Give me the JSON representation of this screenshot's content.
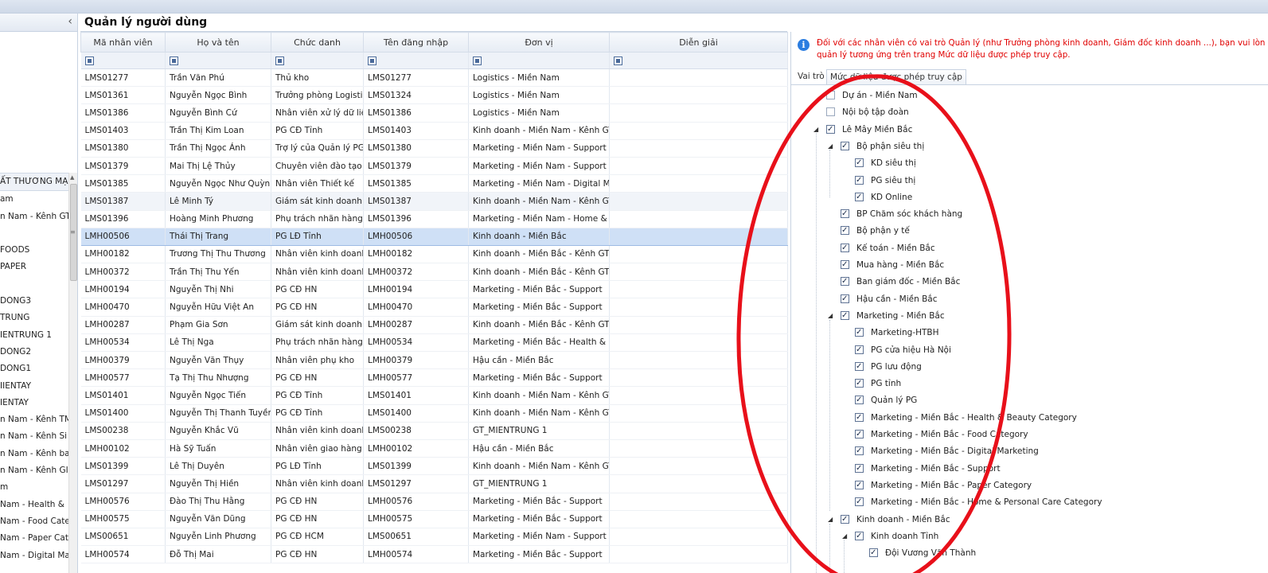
{
  "page_title": "Quản lý người dùng",
  "sidebar": {
    "items": [
      "ẤT THƯƠNG MẠI",
      "am",
      "n Nam - Kênh GT",
      "",
      "FOODS",
      "PAPER",
      "",
      "DONG3",
      "TRUNG",
      "IENTRUNG 1",
      "DONG2",
      "DONG1",
      "IIENTAY",
      "IENTAY",
      "n Nam - Kênh TM",
      "n Nam - Kênh Si",
      "n Nam - Kênh ba",
      "n Nam - Kênh GI",
      "m",
      "Nam - Health &",
      "Nam - Food Cate",
      "Nam - Paper Cat",
      "Nam - Digital Ma"
    ]
  },
  "grid": {
    "columns": [
      "Mã nhân viên",
      "Họ và tên",
      "Chức danh",
      "Tên đăng nhập",
      "Đơn vị",
      "Diễn giải"
    ],
    "rows": [
      [
        "LMS01277",
        "Trần Văn Phú",
        "Thủ kho",
        "LMS01277",
        "Logistics - Miền Nam",
        ""
      ],
      [
        "LMS01361",
        "Nguyễn Ngọc Bình",
        "Trưởng phòng Logistic",
        "LMS01324",
        "Logistics - Miền Nam",
        ""
      ],
      [
        "LMS01386",
        "Nguyễn Bình Cứ",
        "Nhân viên xử lý dữ liệ",
        "LMS01386",
        "Logistics - Miền Nam",
        ""
      ],
      [
        "LMS01403",
        "Trần Thị Kim Loan",
        "PG CĐ Tỉnh",
        "LMS01403",
        "Kinh doanh - Miền Nam - Kênh GT",
        ""
      ],
      [
        "LMS01380",
        "Trần Thị Ngọc Ánh",
        "Trợ lý của Quản lý PG",
        "LMS01380",
        "Marketing - Miền Nam - Support",
        ""
      ],
      [
        "LMS01379",
        "Mai Thị Lệ Thủy",
        "Chuyên viên đào tạo",
        "LMS01379",
        "Marketing - Miền Nam - Support",
        ""
      ],
      [
        "LMS01385",
        "Nguyễn Ngọc Như Quỳnh",
        "Nhân viên Thiết kế",
        "LMS01385",
        "Marketing - Miền Nam - Digital Mar",
        ""
      ],
      [
        "LMS01387",
        "Lê Minh Tý",
        "Giám sát kinh doanh",
        "LMS01387",
        "Kinh doanh - Miền Nam - Kênh GT",
        ""
      ],
      [
        "LMS01396",
        "Hoàng Minh Phương",
        "Phụ trách nhãn hàng",
        "LMS01396",
        "Marketing - Miền Nam - Home & Pe",
        ""
      ],
      [
        "LMH00506",
        "Thái Thị Trang",
        "PG LĐ Tỉnh",
        "LMH00506",
        "Kinh doanh - Miền Bắc",
        ""
      ],
      [
        "LMH00182",
        "Trương Thị Thu Thương",
        "Nhân viên kinh doanh",
        "LMH00182",
        "Kinh doanh - Miền Bắc - Kênh GT",
        ""
      ],
      [
        "LMH00372",
        "Trần Thị Thu Yến",
        "Nhân viên kinh doanh",
        "LMH00372",
        "Kinh doanh - Miền Bắc - Kênh GT",
        ""
      ],
      [
        "LMH00194",
        "Nguyễn Thị Nhi",
        "PG CĐ HN",
        "LMH00194",
        "Marketing - Miền Bắc - Support",
        ""
      ],
      [
        "LMH00470",
        "Nguyễn Hữu Việt An",
        "PG CĐ HN",
        "LMH00470",
        "Marketing - Miền Bắc - Support",
        ""
      ],
      [
        "LMH00287",
        "Phạm Gia Sơn",
        "Giám sát kinh doanh",
        "LMH00287",
        "Kinh doanh - Miền Bắc - Kênh GT",
        ""
      ],
      [
        "LMH00534",
        "Lê Thị Nga",
        "Phụ trách nhãn hàng",
        "LMH00534",
        "Marketing - Miền Bắc - Health & Be",
        ""
      ],
      [
        "LMH00379",
        "Nguyễn Văn Thụy",
        "Nhân viên phụ kho",
        "LMH00379",
        "Hậu cần - Miền Bắc",
        ""
      ],
      [
        "LMH00577",
        "Tạ Thị Thu Nhượng",
        "PG CĐ HN",
        "LMH00577",
        "Marketing - Miền Bắc - Support",
        ""
      ],
      [
        "LMS01401",
        "Nguyễn Ngọc Tiến",
        "PG CĐ Tỉnh",
        "LMS01401",
        "Kinh doanh - Miền Nam - Kênh GT",
        ""
      ],
      [
        "LMS01400",
        "Nguyễn Thị Thanh Tuyền",
        "PG CĐ Tỉnh",
        "LMS01400",
        "Kinh doanh - Miền Nam - Kênh GT",
        ""
      ],
      [
        "LMS00238",
        "Nguyễn Khắc Vũ",
        "Nhân viên kinh doanh",
        "LMS00238",
        "GT_MIENTRUNG 1",
        ""
      ],
      [
        "LMH00102",
        "Hà Sỹ Tuấn",
        "Nhân viên giao hàng x",
        "LMH00102",
        "Hậu cần - Miền Bắc",
        ""
      ],
      [
        "LMS01399",
        "Lê Thị Duyên",
        "PG LĐ Tỉnh",
        "LMS01399",
        "Kinh doanh - Miền Nam - Kênh GT",
        ""
      ],
      [
        "LMS01297",
        "Nguyễn Thị Hiền",
        "Nhân viên kinh doanh",
        "LMS01297",
        "GT_MIENTRUNG 1",
        ""
      ],
      [
        "LMH00576",
        "Đào Thị Thu Hằng",
        "PG CĐ HN",
        "LMH00576",
        "Marketing - Miền Bắc - Support",
        ""
      ],
      [
        "LMH00575",
        "Nguyễn Văn Dũng",
        "PG CĐ HN",
        "LMH00575",
        "Marketing - Miền Bắc - Support",
        ""
      ],
      [
        "LMS00651",
        "Nguyễn Linh Phương",
        "PG CĐ HCM",
        "LMS00651",
        "Marketing - Miền Nam - Support",
        ""
      ],
      [
        "LMH00574",
        "Đỗ Thị Mai",
        "PG CĐ HN",
        "LMH00574",
        "Marketing - Miền Bắc - Support",
        ""
      ]
    ]
  },
  "right_panel": {
    "notice_line1": "Đối với các nhân viên có vai trò Quản lý (như Trưởng phòng kinh doanh, Giám đốc kinh doanh ...), bạn vui lòn",
    "notice_line2": "quản lý tương ứng trên trang Mức dữ liệu được phép truy cập.",
    "tabs": [
      "Vai trò",
      "Mức dữ liệu được phép truy cập"
    ],
    "tree": [
      {
        "label": "Dự án - Miền Nam",
        "level": 0,
        "checked": false,
        "expand": ""
      },
      {
        "label": "Nội bộ tập đoàn",
        "level": 0,
        "checked": false,
        "expand": ""
      },
      {
        "label": "Lê Mây Miền Bắc",
        "level": 0,
        "checked": true,
        "expand": "◢"
      },
      {
        "label": "Bộ phận siêu thị",
        "level": 1,
        "checked": true,
        "expand": "◢"
      },
      {
        "label": "KD siêu thị",
        "level": 2,
        "checked": true,
        "expand": ""
      },
      {
        "label": "PG siêu thị",
        "level": 2,
        "checked": true,
        "expand": ""
      },
      {
        "label": "KD Online",
        "level": 2,
        "checked": true,
        "expand": ""
      },
      {
        "label": "BP Chăm sóc khách hàng",
        "level": 1,
        "checked": true,
        "expand": ""
      },
      {
        "label": "Bộ phận y tế",
        "level": 1,
        "checked": true,
        "expand": ""
      },
      {
        "label": "Kế toán - Miền Bắc",
        "level": 1,
        "checked": true,
        "expand": ""
      },
      {
        "label": "Mua hàng - Miền Bắc",
        "level": 1,
        "checked": true,
        "expand": ""
      },
      {
        "label": "Ban giám đốc - Miền Bắc",
        "level": 1,
        "checked": true,
        "expand": ""
      },
      {
        "label": "Hậu cần - Miền Bắc",
        "level": 1,
        "checked": true,
        "expand": ""
      },
      {
        "label": "Marketing - Miền Bắc",
        "level": 1,
        "checked": true,
        "expand": "◢"
      },
      {
        "label": "Marketing-HTBH",
        "level": 2,
        "checked": true,
        "expand": ""
      },
      {
        "label": "PG cửa hiệu Hà Nội",
        "level": 2,
        "checked": true,
        "expand": ""
      },
      {
        "label": "PG lưu động",
        "level": 2,
        "checked": true,
        "expand": ""
      },
      {
        "label": "PG tỉnh",
        "level": 2,
        "checked": true,
        "expand": ""
      },
      {
        "label": "Quản lý PG",
        "level": 2,
        "checked": true,
        "expand": ""
      },
      {
        "label": "Marketing - Miền Bắc - Health & Beauty Category",
        "level": 2,
        "checked": true,
        "expand": ""
      },
      {
        "label": "Marketing - Miền Bắc - Food Category",
        "level": 2,
        "checked": true,
        "expand": ""
      },
      {
        "label": "Marketing - Miền Bắc - Digital Marketing",
        "level": 2,
        "checked": true,
        "expand": ""
      },
      {
        "label": "Marketing - Miền Bắc - Support",
        "level": 2,
        "checked": true,
        "expand": ""
      },
      {
        "label": "Marketing - Miền Bắc - Paper Category",
        "level": 2,
        "checked": true,
        "expand": ""
      },
      {
        "label": "Marketing - Miền Bắc - Home & Personal Care Category",
        "level": 2,
        "checked": true,
        "expand": ""
      },
      {
        "label": "Kinh doanh - Miền Bắc",
        "level": 1,
        "checked": true,
        "expand": "◢"
      },
      {
        "label": "Kinh doanh Tỉnh",
        "level": 2,
        "checked": true,
        "expand": "◢"
      },
      {
        "label": "Đội Vương Văn Thành",
        "level": 3,
        "checked": true,
        "expand": ""
      }
    ]
  },
  "annotation": {
    "color": "#e8101a",
    "shape": "ellipse"
  },
  "selected_row_index": 9,
  "hover_row_index": 7
}
